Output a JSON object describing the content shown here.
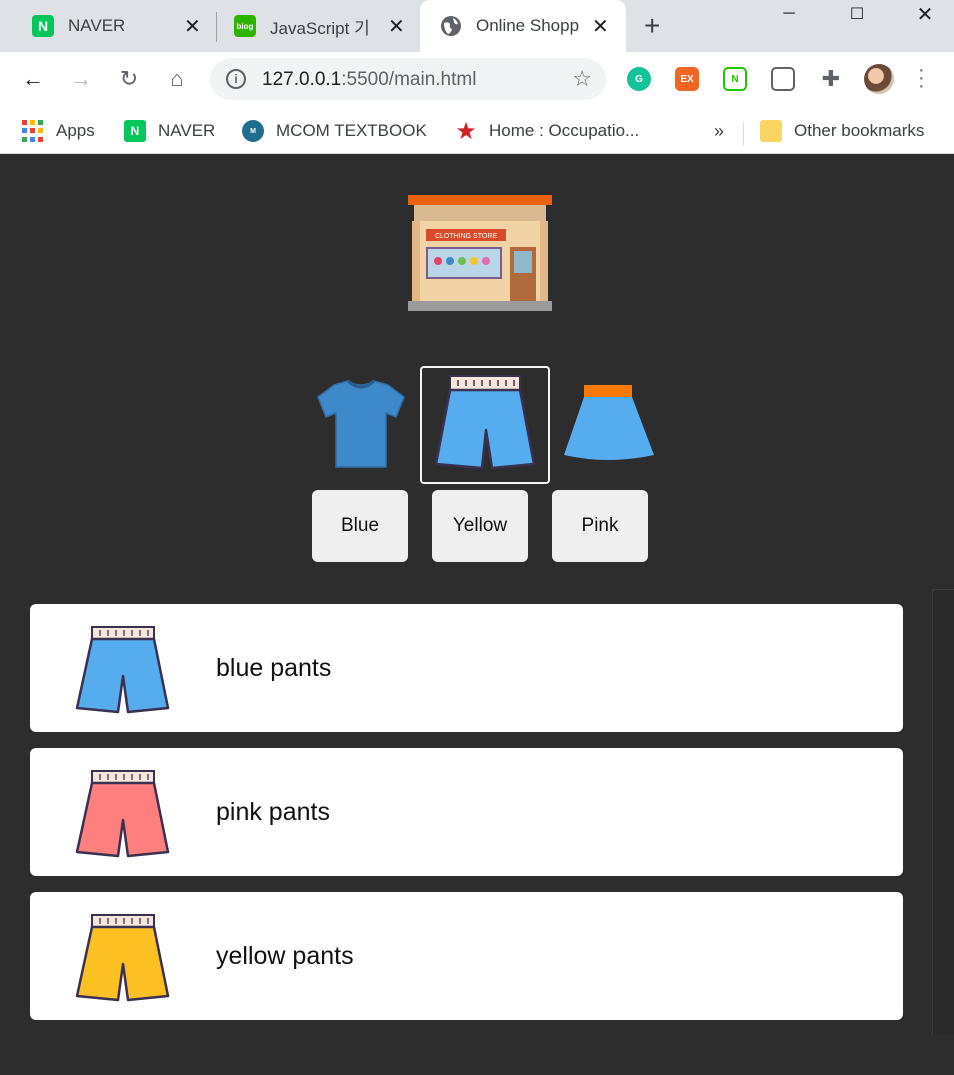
{
  "browser": {
    "tabs": [
      {
        "title": "NAVER",
        "icon": "naver-icon"
      },
      {
        "title": "JavaScript 기",
        "icon": "blog-icon"
      },
      {
        "title": "Online Shopp",
        "icon": "globe-icon",
        "active": true
      }
    ],
    "url_host": "127.0.0.1",
    "url_rest": ":5500/main.html",
    "bookmarks": [
      {
        "label": "Apps",
        "icon": "apps-icon"
      },
      {
        "label": "NAVER",
        "icon": "naver-icon"
      },
      {
        "label": "MCOM TEXTBOOK",
        "icon": "mcom-icon"
      },
      {
        "label": "Home : Occupatio...",
        "icon": "star-logo-icon"
      }
    ],
    "overflow": "»",
    "other_bookmarks": "Other bookmarks",
    "naver_glyph": "N",
    "blog_glyph": "blog",
    "ext_ex": "EX",
    "ext_n": "N"
  },
  "page": {
    "logo_text": "CLOTHING STORE",
    "categories": [
      {
        "name": "tshirt",
        "icon": "tshirt-icon"
      },
      {
        "name": "pants",
        "icon": "pants-icon",
        "active": true
      },
      {
        "name": "skirt",
        "icon": "skirt-icon"
      }
    ],
    "color_buttons": [
      "Blue",
      "Yellow",
      "Pink"
    ],
    "items": [
      {
        "label": "blue pants",
        "color": "#55acee"
      },
      {
        "label": "pink pants",
        "color": "#ff7f7f"
      },
      {
        "label": "yellow pants",
        "color": "#fdc023"
      }
    ]
  },
  "colors": {
    "background": "#2d2d2d",
    "tshirt": "#3d89c9",
    "pants": "#55acee",
    "skirt_body": "#55acee",
    "skirt_band": "#ff7a00"
  }
}
